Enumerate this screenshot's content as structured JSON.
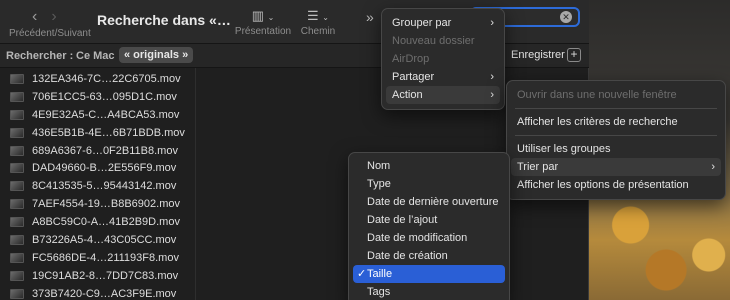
{
  "toolbar": {
    "back_icon": "chevron-left",
    "forward_icon": "chevron-right",
    "nav_label": "Précédent/Suivant",
    "title": "Recherche dans «…",
    "view_label": "Présentation",
    "path_label": "Chemin",
    "more_glyph": "»"
  },
  "search": {
    "value": "",
    "clear_icon": "clear-circle"
  },
  "scope": {
    "label": "Rechercher :",
    "mac": "Ce Mac",
    "originals": "« originals »",
    "save_label": "Enregistrer",
    "add_label": "+"
  },
  "files": [
    "132EA346-7C…22C6705.mov",
    "706E1CC5-63…095D1C.mov",
    "4E9E32A5-C…A4BCA53.mov",
    "436E5B1B-4E…6B71BDB.mov",
    "689A6367-6…0F2B11B8.mov",
    "DAD49660-B…2E556F9.mov",
    "8C413535-5…95443142.mov",
    "7AEF4554-19…B8B6902.mov",
    "A8BC59C0-A…41B2B9D.mov",
    "B73226A5-4…43C05CC.mov",
    "FC5686DE-4…211193F8.mov",
    "19C91AB2-8…7DD7C83.mov",
    "373B7420-C9…AC3F9E.mov"
  ],
  "menu_main": [
    {
      "label": "Grouper par",
      "submenu": true,
      "disabled": false
    },
    {
      "label": "Nouveau dossier",
      "submenu": false,
      "disabled": true
    },
    {
      "label": "AirDrop",
      "submenu": false,
      "disabled": true
    },
    {
      "label": "Partager",
      "submenu": true,
      "disabled": false
    },
    {
      "label": "Action",
      "submenu": true,
      "disabled": false,
      "highlighted": true
    }
  ],
  "menu_action": {
    "open_new_window": "Ouvrir dans une nouvelle fenêtre",
    "show_criteria": "Afficher les critères de recherche",
    "use_groups": "Utiliser les groupes",
    "sort_by": "Trier par",
    "show_view_options": "Afficher les options de présentation"
  },
  "menu_sort": {
    "items": [
      "Nom",
      "Type",
      "Date de dernière ouverture",
      "Date de l’ajout",
      "Date de modification",
      "Date de création",
      "Taille",
      "Tags"
    ],
    "selected": "Taille",
    "check": "✓"
  },
  "colors": {
    "selection": "#2a5fd6",
    "focus_ring": "#2d6bd8"
  }
}
